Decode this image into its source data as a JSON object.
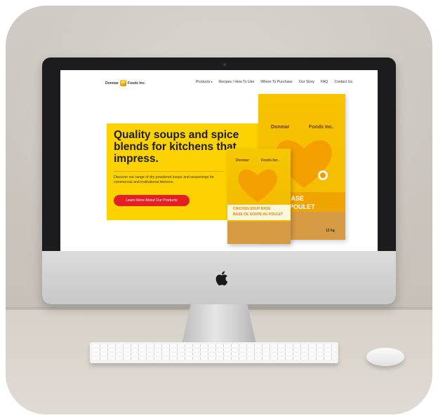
{
  "site": {
    "brand": {
      "name_left": "Donmar",
      "mark": "df",
      "name_right": "Foods Inc."
    },
    "nav": {
      "items": [
        {
          "label": "Products",
          "has_caret": true
        },
        {
          "label": "Recipes / How To Use"
        },
        {
          "label": "Where To Purchase"
        },
        {
          "label": "Our Story"
        },
        {
          "label": "FAQ"
        },
        {
          "label": "Contact Us"
        }
      ],
      "caret": "▾"
    },
    "hero": {
      "title": "Quality soups and spice blends for kitchens that impress.",
      "description": "Discover our range of dry powdered soups and seasonings for commercial and institutional kitchens.",
      "cta_label": "Learn More About Our Products",
      "accent_color": "#fcd200",
      "cta_color": "#e31e24"
    },
    "products": {
      "large_bag": {
        "brand": "Donmar",
        "brand_right": "Foods Inc.",
        "label_line1": "SOUP BASE",
        "label_line2": "IPE AU POULET",
        "weight": "12 kg"
      },
      "small_bag": {
        "brand": "Donmar",
        "brand_right": "Foods Inc.",
        "label_line1": "CHICKEN SOUP BASE",
        "label_line2": "BASE DE SOUPE AU POULET"
      }
    }
  },
  "scene": {
    "icons": [
      "apple-logo-icon",
      "camera-icon"
    ]
  }
}
